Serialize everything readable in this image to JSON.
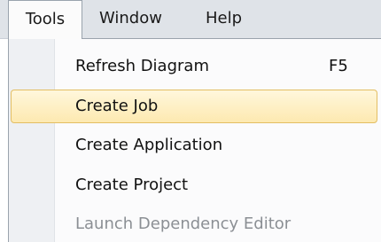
{
  "menubar": {
    "items": [
      {
        "label": "Tools"
      },
      {
        "label": "Window"
      },
      {
        "label": "Help"
      }
    ]
  },
  "tools_menu": {
    "items": [
      {
        "label": "Refresh Diagram",
        "shortcut": "F5",
        "state": "normal"
      },
      {
        "label": "Create Job",
        "state": "highlighted"
      },
      {
        "label": "Create Application",
        "state": "normal"
      },
      {
        "label": "Create Project",
        "state": "normal"
      },
      {
        "label": "Launch Dependency Editor",
        "state": "disabled"
      }
    ]
  },
  "colors": {
    "menubar_bg": "#dfe3e8",
    "menu_bg": "#fbfbfc",
    "gutter_bg": "#eef0f3",
    "highlight_border": "#e3be63",
    "highlight_fill": "#fde9b0",
    "disabled_text": "#8b8f94"
  }
}
